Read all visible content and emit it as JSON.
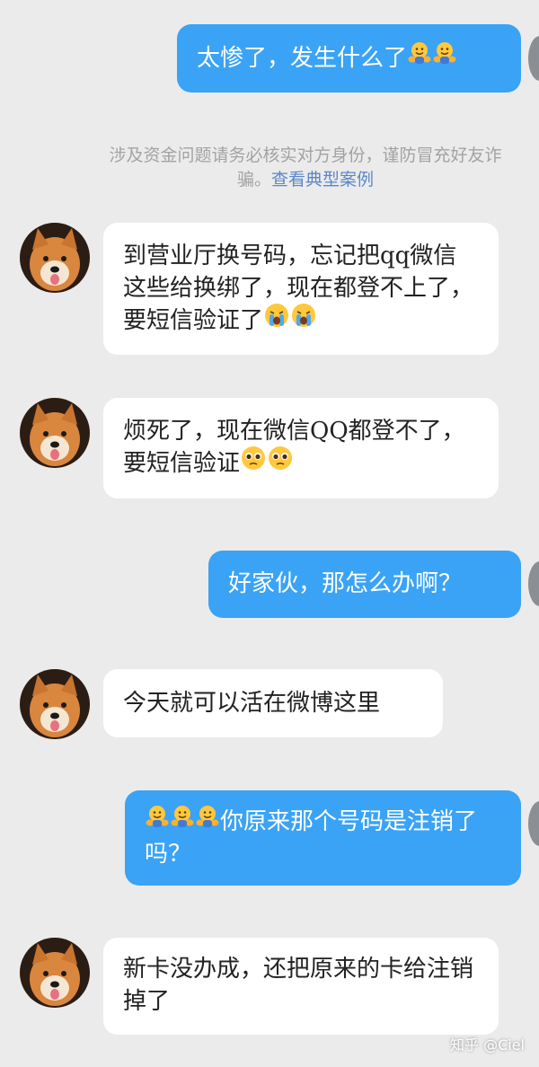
{
  "chat": {
    "messages": [
      {
        "side": "out",
        "text": "太惨了，发生什么了",
        "emojis": [
          "hugging-face-icon",
          "hugging-face-icon"
        ]
      },
      {
        "side": "in",
        "text": "到营业厅换号码，忘记把qq微信这些给换绑了，现在都登不上了，要短信验证了",
        "emojis": [
          "crying-face-icon",
          "crying-face-icon"
        ]
      },
      {
        "side": "in",
        "text": "烦死了，现在微信QQ都登不了，要短信验证",
        "emojis": [
          "pleading-face-icon",
          "pleading-face-icon"
        ]
      },
      {
        "side": "out",
        "text": "好家伙，那怎么办啊？",
        "emojis": []
      },
      {
        "side": "in",
        "text": "今天就可以活在微博这里",
        "emojis": []
      },
      {
        "side": "out",
        "text": "你原来那个号码是注销了吗？",
        "emojis": [
          "hugging-face-icon",
          "hugging-face-icon",
          "hugging-face-icon"
        ]
      },
      {
        "side": "in",
        "text": "新卡没办成，还把原来的卡给注销掉了",
        "emojis": []
      }
    ],
    "notice": {
      "line1": "涉及资金问题请务必核实对方身份，谨防冒充好友诈",
      "line2_prefix": "骗。",
      "link": "查看典型案例"
    }
  },
  "watermark": "知乎 @Ciel",
  "colors": {
    "background": "#ebebeb",
    "outgoing_bubble": "#3aa3f5",
    "incoming_bubble": "#ffffff",
    "notice_text": "#a3a3a3",
    "notice_link": "#5b87c7"
  }
}
